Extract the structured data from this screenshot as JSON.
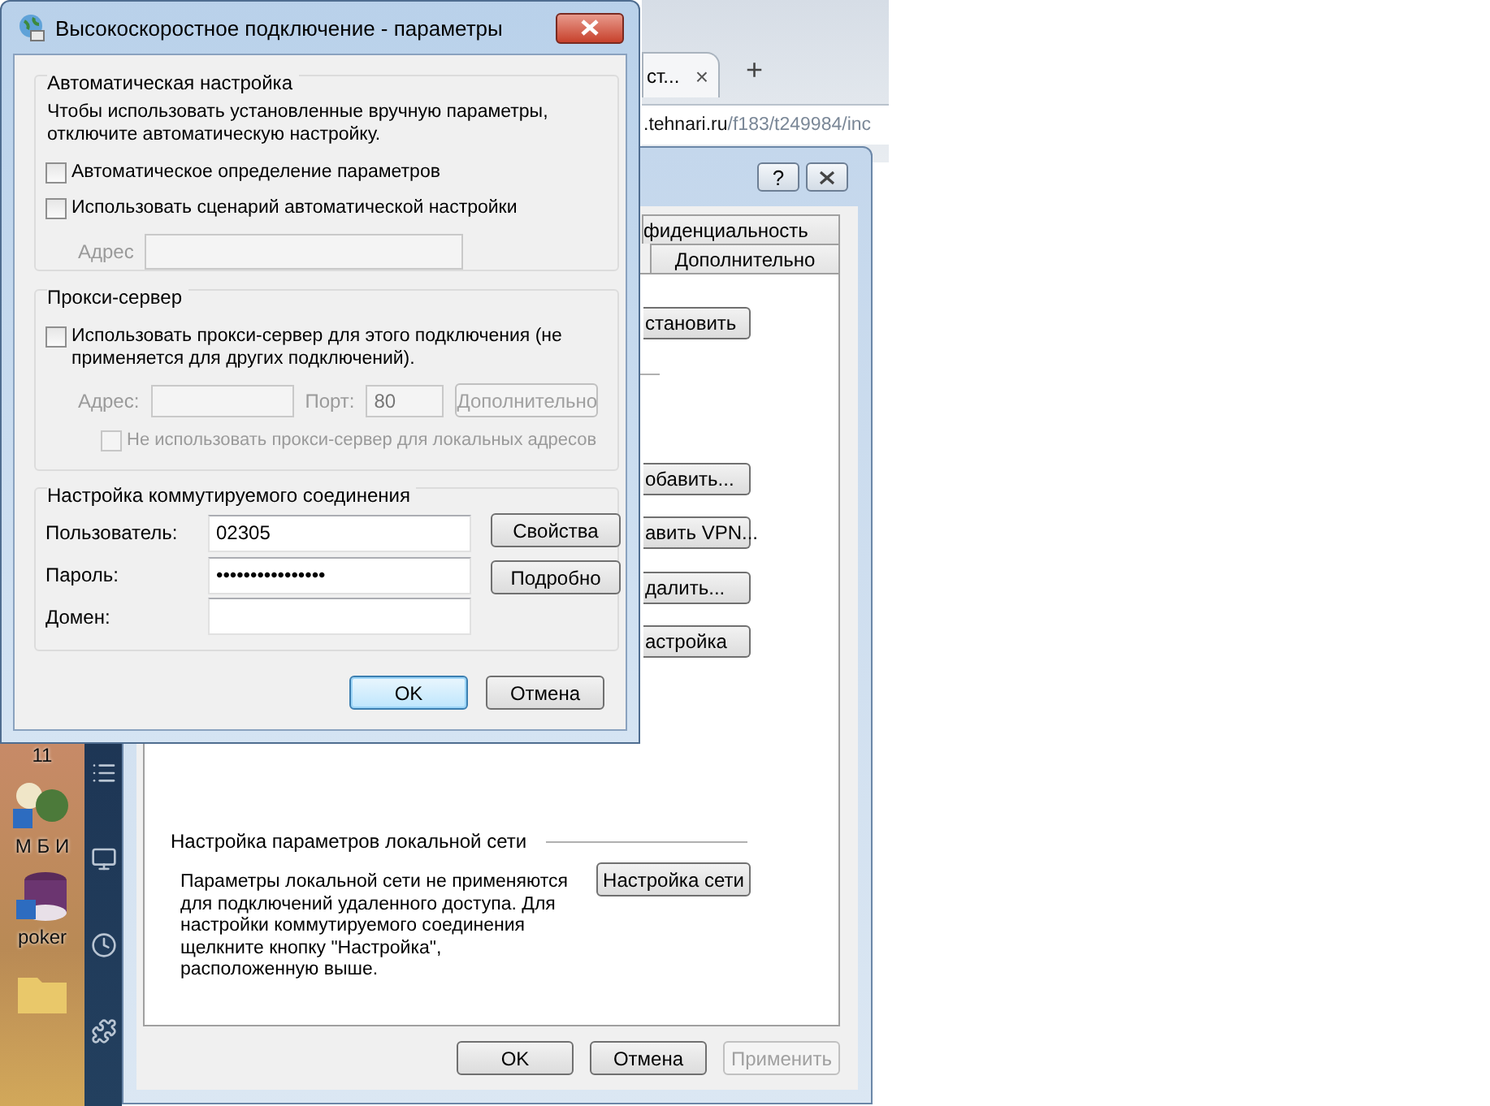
{
  "desktop": {
    "labels": [
      {
        "text": "11"
      },
      {
        "text": "М Б И"
      },
      {
        "text": "poker"
      }
    ]
  },
  "browser": {
    "tab": {
      "title": "ст...",
      "close": "×"
    },
    "new_tab": "+",
    "address": {
      "host": ".tehnari.ru",
      "path": "/f183/t249984/inc"
    }
  },
  "properties_window": {
    "help": "?",
    "tabs": [
      {
        "label": "фиденциальность",
        "selected": false
      },
      {
        "label": "Дополнительно",
        "selected": false
      }
    ],
    "side_buttons": [
      "становить",
      "обавить...",
      "авить VPN...",
      "далить...",
      "астройка"
    ],
    "lan": {
      "heading": "Настройка параметров локальной сети",
      "text": "Параметры локальной сети не применяются для подключений удаленного доступа. Для настройки коммутируемого соединения щелкните кнопку \"Настройка\", расположенную выше.",
      "button": "Настройка сети"
    },
    "buttons": [
      {
        "label": "OK",
        "disabled": false
      },
      {
        "label": "Отмена",
        "disabled": false
      },
      {
        "label": "Применить",
        "disabled": true
      }
    ]
  },
  "settings_dialog": {
    "title": "Высокоскоростное подключение - параметры",
    "auto": {
      "heading": "Автоматическая настройка",
      "text": "Чтобы использовать установленные вручную параметры, отключите автоматическую настройку.",
      "options": [
        {
          "label": "Автоматическое определение параметров",
          "checked": false
        },
        {
          "label": "Использовать сценарий автоматической настройки",
          "checked": false
        }
      ],
      "address": {
        "label": "Адрес",
        "disabled": true
      }
    },
    "proxy": {
      "heading": "Прокси-сервер",
      "option": {
        "label": "Использовать прокси-сервер для этого подключения (не применяется для других подключений).",
        "checked": false
      },
      "disabled": true,
      "address_label": "Адрес:",
      "port_label": "Порт:",
      "port": "80",
      "advanced": "Дополнительно",
      "bypass": {
        "label": "Не использовать прокси-сервер для локальных адресов",
        "checked": false
      }
    },
    "dialup": {
      "heading": "Настройка коммутируемого соединения",
      "fields": [
        {
          "label": "Пользователь:",
          "value": "02305"
        },
        {
          "label": "Пароль:",
          "value": "••••••••••••••••"
        },
        {
          "label": "Домен:"
        }
      ],
      "buttons": [
        "Свойства",
        "Подробно"
      ]
    },
    "buttons": [
      {
        "label": "OK",
        "default": true
      },
      {
        "label": "Отмена",
        "default": false
      }
    ]
  }
}
